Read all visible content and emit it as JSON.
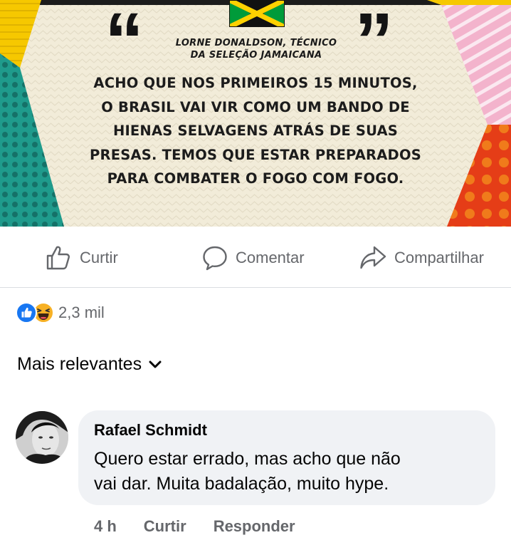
{
  "post": {
    "attribution_lines": [
      "LORNE DONALDSON, TÉCNICO",
      "DA SELEÇÃO JAMAICANA"
    ],
    "quote_lines": [
      "ACHO QUE NOS PRIMEIROS 15 MINUTOS,",
      "O BRASIL VAI VIR COMO UM BANDO DE",
      "HIENAS SELVAGENS ATRÁS DE SUAS",
      "PRESAS. TEMOS QUE ESTAR PREPARADOS",
      "PARA COMBATER O FOGO COM FOGO."
    ],
    "quote_open": "“",
    "quote_close": "”"
  },
  "actions": {
    "like_label": "Curtir",
    "comment_label": "Comentar",
    "share_label": "Compartilhar",
    "like_icon": "thumbs-up-icon",
    "comment_icon": "speech-bubble-icon",
    "share_icon": "share-arrow-icon"
  },
  "reactions": {
    "types": [
      "like",
      "haha"
    ],
    "count": "2,3 mil"
  },
  "sort": {
    "label": "Mais relevantes",
    "icon": "chevron-down-icon"
  },
  "comment": {
    "author": "Rafael Schmidt",
    "text_lines": [
      "Quero estar errado, mas acho que não",
      "vai dar. Muita badalação, muito hype."
    ],
    "time": "4 h",
    "like_label": "Curtir",
    "reply_label": "Responder"
  },
  "colors": {
    "muted_text": "#65676b",
    "bubble_bg": "#f0f2f5",
    "like_blue": "#1877f2",
    "haha_yellow": "#f7b125"
  }
}
